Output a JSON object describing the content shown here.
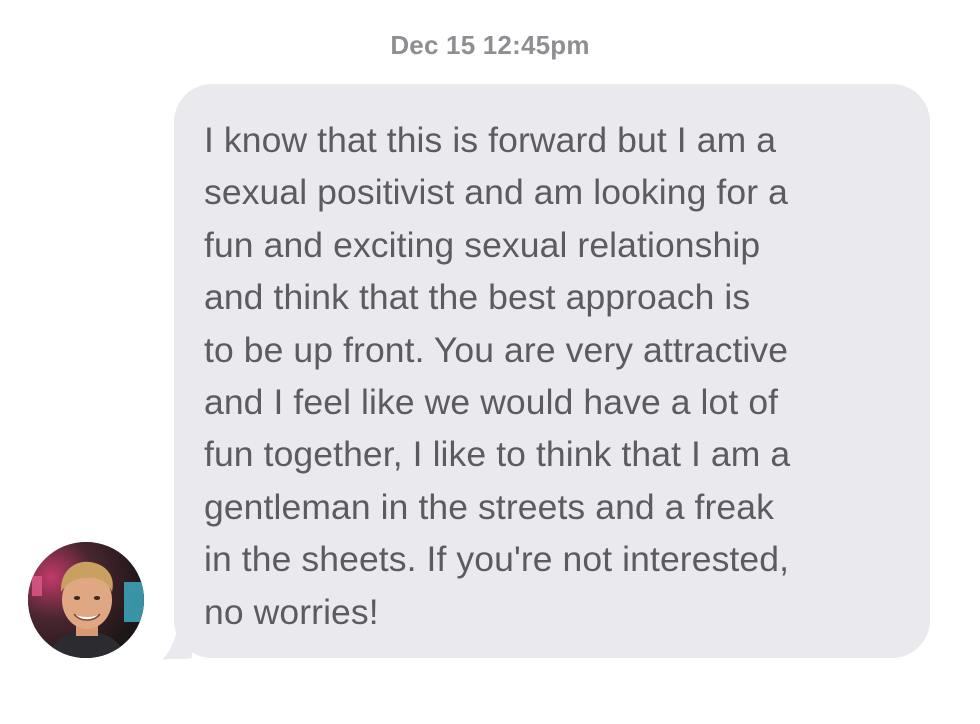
{
  "thread": {
    "timestamp": "Dec 15 12:45pm",
    "message": {
      "text": "I know that this is forward but I am a\nsexual positivist and am looking for a\nfun and exciting sexual relationship\nand think that the best approach is\nto be up front. You are very attractive\nand I feel like we would have a lot of\nfun together, I like to think that I am a\ngentleman in the streets and a freak\nin the sheets. If you're not interested,\nno worries!",
      "bubble_color": "#e9e9ee",
      "text_color": "#5b5b60"
    },
    "sender": {
      "avatar_icon": "profile-photo"
    }
  }
}
